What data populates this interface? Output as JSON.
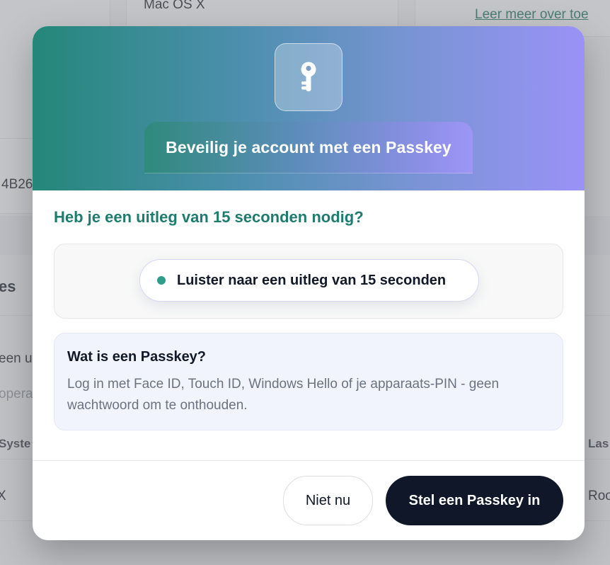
{
  "background": {
    "os_value": "Mac OS X",
    "learn_more_link": "Leer meer over toe",
    "id_fragment": "4B26",
    "section_fragment": "es",
    "text_fragment_1": "een u",
    "text_fragment_2": "opera",
    "col_system_fragment": "Syste",
    "col_last_fragment": "Las",
    "row_value_fragment": "X",
    "row_value_fragment_2": "Roo"
  },
  "modal": {
    "hero_icon": "key-icon",
    "title": "Beveilig je account met een Passkey",
    "question": "Heb je een uitleg van 15 seconden nodig?",
    "listen_button": "Luister naar een uitleg van 15 seconden",
    "info": {
      "title": "Wat is een Passkey?",
      "body": "Log in met Face ID, Touch ID, Windows Hello of je apparaats-PIN - geen wachtwoord om te onthouden."
    },
    "buttons": {
      "secondary": "Niet nu",
      "primary": "Stel een Passkey in"
    }
  },
  "colors": {
    "accent_teal": "#1d7c6e",
    "gradient_start": "#24877a",
    "gradient_end": "#9a92f7",
    "primary_button": "#0f1728"
  }
}
